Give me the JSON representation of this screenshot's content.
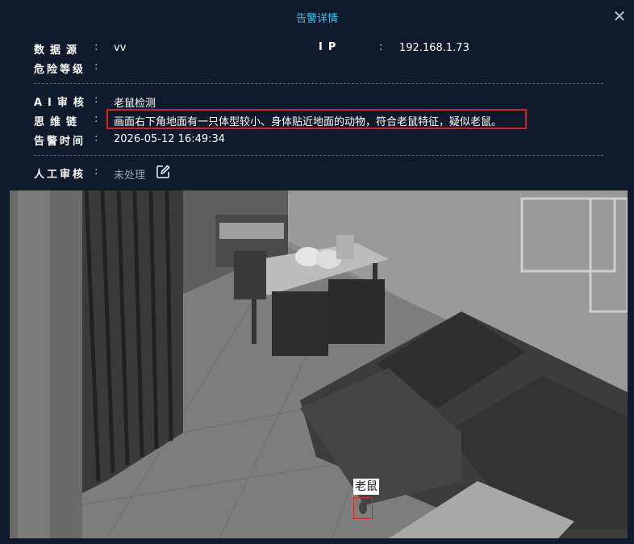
{
  "dialog": {
    "title": "告警详情",
    "close_icon": "close-icon"
  },
  "fields": {
    "data_source": {
      "label": "数据源",
      "colon": ":",
      "value": "vv"
    },
    "ip": {
      "label": "IP",
      "colon": ":",
      "value": "192.168.1.73"
    },
    "danger_level": {
      "label": "危险等级",
      "colon": ":",
      "value": ""
    },
    "ai_review": {
      "label": "AI审核",
      "colon": ":",
      "value": "老鼠检测"
    },
    "thought_chain": {
      "label": "思维链",
      "colon": ":",
      "value": "画面右下角地面有一只体型较小、身体贴近地面的动物，符合老鼠特征，疑似老鼠。"
    },
    "alert_time": {
      "label": "告警时间",
      "colon": ":",
      "value": "2026-05-12 16:49:34"
    },
    "manual_review": {
      "label": "人工审核",
      "colon": ":",
      "value": "未处理",
      "edit_icon": "edit-icon"
    }
  },
  "image": {
    "detection_label": "老鼠"
  },
  "colors": {
    "background": "#0f1b2d",
    "title": "#3fc3ef",
    "highlight_border": "#d62020",
    "detection_box": "#d12a2a"
  }
}
